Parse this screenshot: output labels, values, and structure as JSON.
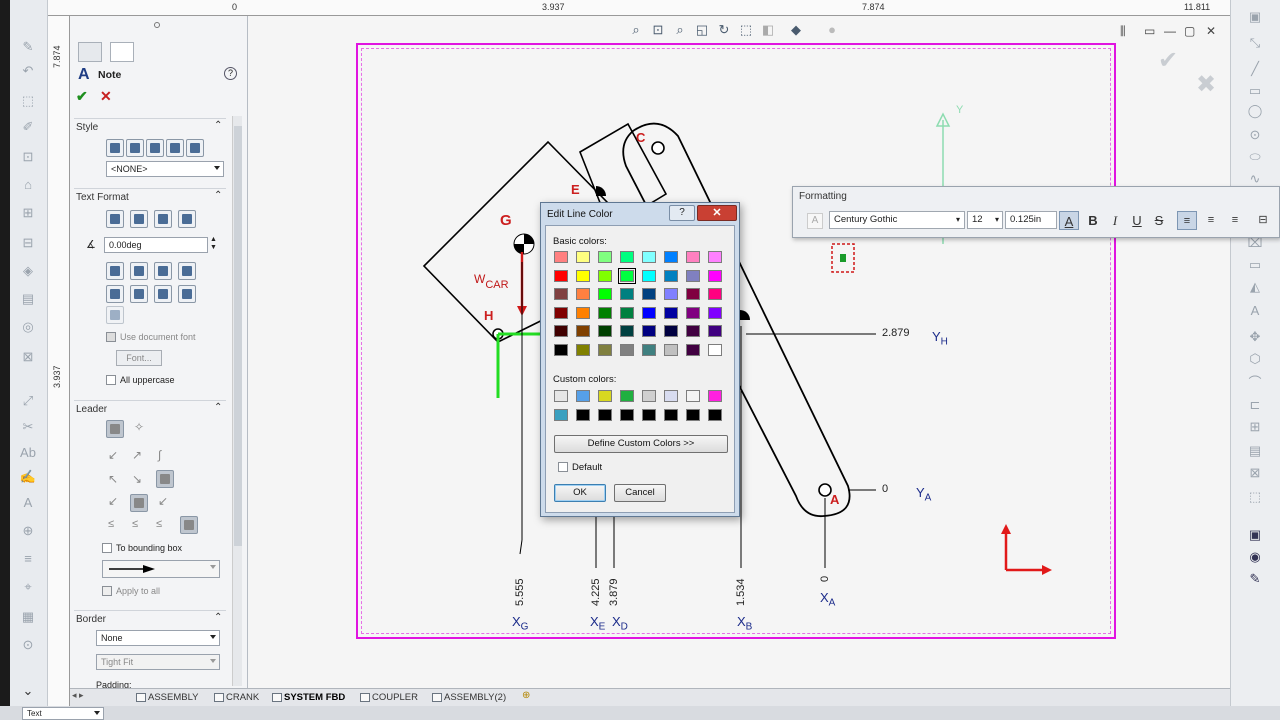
{
  "ruler": {
    "top_ticks": [
      "0",
      "3.937",
      "7.874",
      "11.811"
    ],
    "left_ticks": [
      "7.874",
      "3.937"
    ]
  },
  "property_manager": {
    "title": "Note",
    "style_section": "Style",
    "style_select": "<NONE>",
    "text_format_section": "Text Format",
    "angle_value": "0.00deg",
    "use_doc_font": "Use document font",
    "font_button": "Font...",
    "all_uppercase": "All uppercase",
    "leader_section": "Leader",
    "to_bounding_box": "To bounding box",
    "apply_to_all": "Apply to all",
    "border_section": "Border",
    "border_select": "None",
    "size_select": "Tight Fit",
    "padding_label": "Padding:"
  },
  "sheet_tabs": [
    {
      "label": "ASSEMBLY",
      "active": false
    },
    {
      "label": "CRANK",
      "active": false
    },
    {
      "label": "SYSTEM FBD",
      "active": true
    },
    {
      "label": "COUPLER",
      "active": false
    },
    {
      "label": "ASSEMBLY(2)",
      "active": false
    }
  ],
  "formatting_toolbar": {
    "title": "Formatting",
    "font": "Century Gothic",
    "size": "12",
    "height": "0.125in",
    "bold": "B",
    "italic": "I",
    "underline": "U",
    "strike": "S"
  },
  "dialog": {
    "title": "Edit Line Color",
    "basic_colors_label": "Basic colors:",
    "custom_colors_label": "Custom colors:",
    "define_custom": "Define Custom Colors >>",
    "default_label": "Default",
    "ok": "OK",
    "cancel": "Cancel",
    "basic_colors": [
      [
        "#ff8080",
        "#ffff80",
        "#80ff80",
        "#00ff80",
        "#80ffff",
        "#0080ff",
        "#ff80c0",
        "#ff80ff"
      ],
      [
        "#ff0000",
        "#ffff00",
        "#80ff00",
        "#00ff40",
        "#00ffff",
        "#0080c0",
        "#8080c0",
        "#ff00ff"
      ],
      [
        "#804040",
        "#ff8040",
        "#00ff00",
        "#008080",
        "#004080",
        "#8080ff",
        "#800040",
        "#ff0080"
      ],
      [
        "#800000",
        "#ff8000",
        "#008000",
        "#008040",
        "#0000ff",
        "#0000a0",
        "#800080",
        "#8000ff"
      ],
      [
        "#400000",
        "#804000",
        "#004000",
        "#004040",
        "#000080",
        "#000040",
        "#400040",
        "#400080"
      ],
      [
        "#000000",
        "#808000",
        "#808040",
        "#808080",
        "#408080",
        "#c0c0c0",
        "#400040",
        "#ffffff"
      ]
    ],
    "custom_colors": [
      [
        "#e6e6e6",
        "#56a0e8",
        "#d8d820",
        "#20b040",
        "#d0d0d0",
        "#d8dcf0",
        "#f4f4f4",
        "#ff20e0"
      ],
      [
        "#3aa0c0",
        "#000000",
        "#000000",
        "#000000",
        "#000000",
        "#000000",
        "#000000",
        "#000000"
      ]
    ]
  },
  "drawing": {
    "points": [
      "C",
      "E",
      "G",
      "H",
      "A"
    ],
    "w_car": "W",
    "w_car_sub": "CAR",
    "y_axis": "Y",
    "dims": {
      "yh": "2.879",
      "ya": "0",
      "xg": "5.555",
      "xe": "4.225",
      "xd": "3.879",
      "xb": "1.534",
      "xa": "0"
    },
    "labels": {
      "yh": "Y",
      "yh_sub": "H",
      "ya": "Y",
      "ya_sub": "A",
      "xg": "X",
      "xg_sub": "G",
      "xe": "X",
      "xe_sub": "E",
      "xd": "X",
      "xd_sub": "D",
      "xb": "X",
      "xb_sub": "B",
      "xa": "X",
      "xa_sub": "A"
    }
  },
  "status": {
    "text_box": "Text"
  }
}
